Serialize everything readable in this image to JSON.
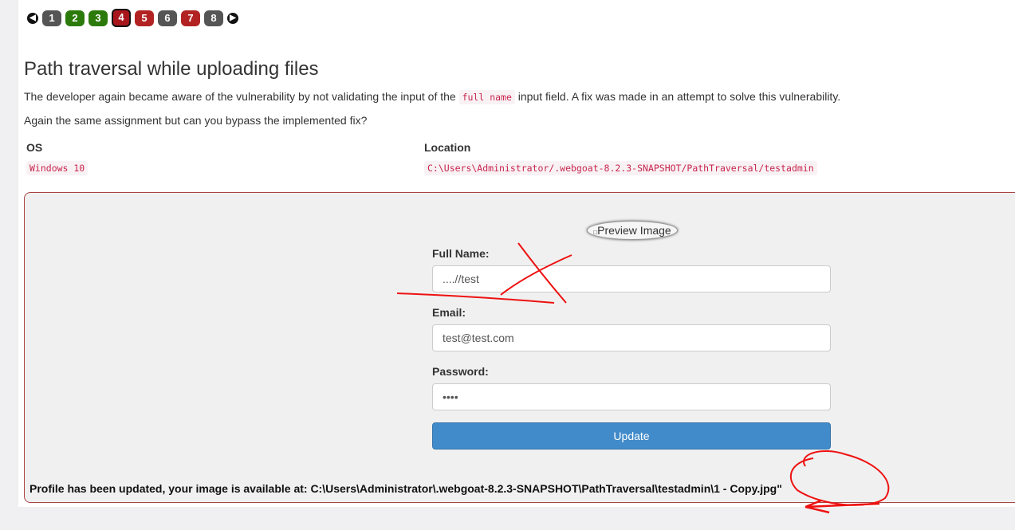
{
  "pager": {
    "pages": [
      {
        "label": "1",
        "state": "gray"
      },
      {
        "label": "2",
        "state": "green"
      },
      {
        "label": "3",
        "state": "green"
      },
      {
        "label": "4",
        "state": "current"
      },
      {
        "label": "5",
        "state": "red"
      },
      {
        "label": "6",
        "state": "gray"
      },
      {
        "label": "7",
        "state": "red"
      },
      {
        "label": "8",
        "state": "gray"
      }
    ],
    "prev_icon": "circle-left-arrow",
    "next_icon": "circle-right-arrow"
  },
  "content": {
    "title": "Path traversal while uploading files",
    "para1_before": "The developer again became aware of the vulnerability by not validating the input of the",
    "para1_code": "full name",
    "para1_after": "input field. A fix was made in an attempt to solve this vulnerability.",
    "para2": "Again the same assignment but can you bypass the implemented fix?",
    "table": {
      "os_header": "OS",
      "location_header": "Location",
      "os_value": "Windows 10",
      "location_value": "C:\\Users\\Administrator/.webgoat-8.2.3-SNAPSHOT/PathTraversal/testadmin"
    }
  },
  "form": {
    "preview_alt": "Preview Image",
    "full_name_label": "Full Name:",
    "full_name_value": "....//test",
    "email_label": "Email:",
    "email_value": "test@test.com",
    "password_label": "Password:",
    "password_value": "••••",
    "update_label": "Update",
    "feedback": "Profile has been updated, your image is available at: C:\\Users\\Administrator\\.webgoat-8.2.3-SNAPSHOT\\PathTraversal\\testadmin\\1 - Copy.jpg\""
  },
  "colors": {
    "current_page": "#a8161b",
    "green_page": "#2b7a0b",
    "red_page": "#b22222",
    "button": "#428bca",
    "card_border": "#a94442",
    "annotation": "#ee1111"
  }
}
